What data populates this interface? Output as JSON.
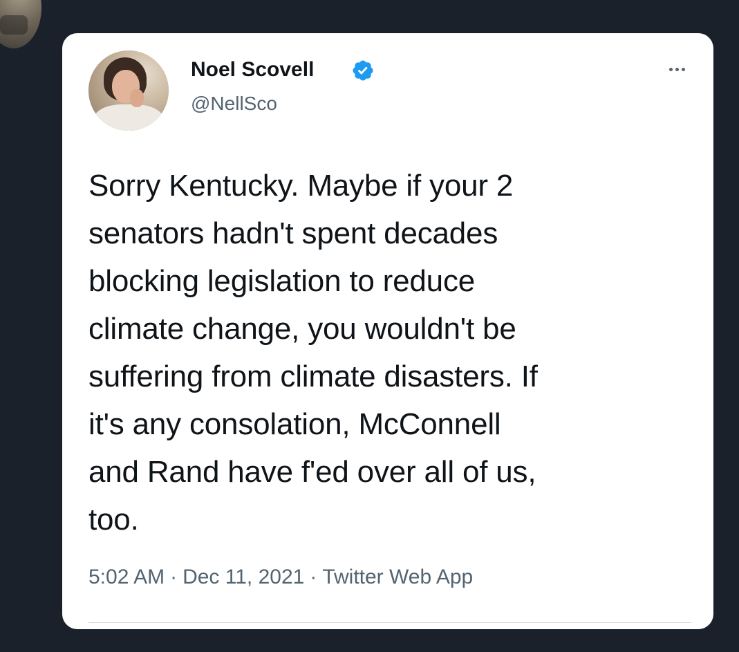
{
  "tweet": {
    "display_name": "Noel Scovell",
    "handle": "@NellSco",
    "text": "Sorry Kentucky. Maybe if your 2\nsenators hadn't spent decades\nblocking legislation to reduce\nclimate change, you wouldn't be\nsuffering from climate disasters. If\nit's any consolation, McConnell\nand Rand have f'ed over all of us,\ntoo.",
    "time": "5:02 AM",
    "date": "Dec 11, 2021",
    "source": "Twitter Web App",
    "separator": "·"
  },
  "icons": {
    "verified": "verified-badge-icon",
    "more": "more-options-icon"
  },
  "colors": {
    "page_background": "#1a212b",
    "card_background": "#ffffff",
    "primary_text": "#0f1419",
    "secondary_text": "#536471",
    "verified_blue": "#1d9bf0"
  }
}
